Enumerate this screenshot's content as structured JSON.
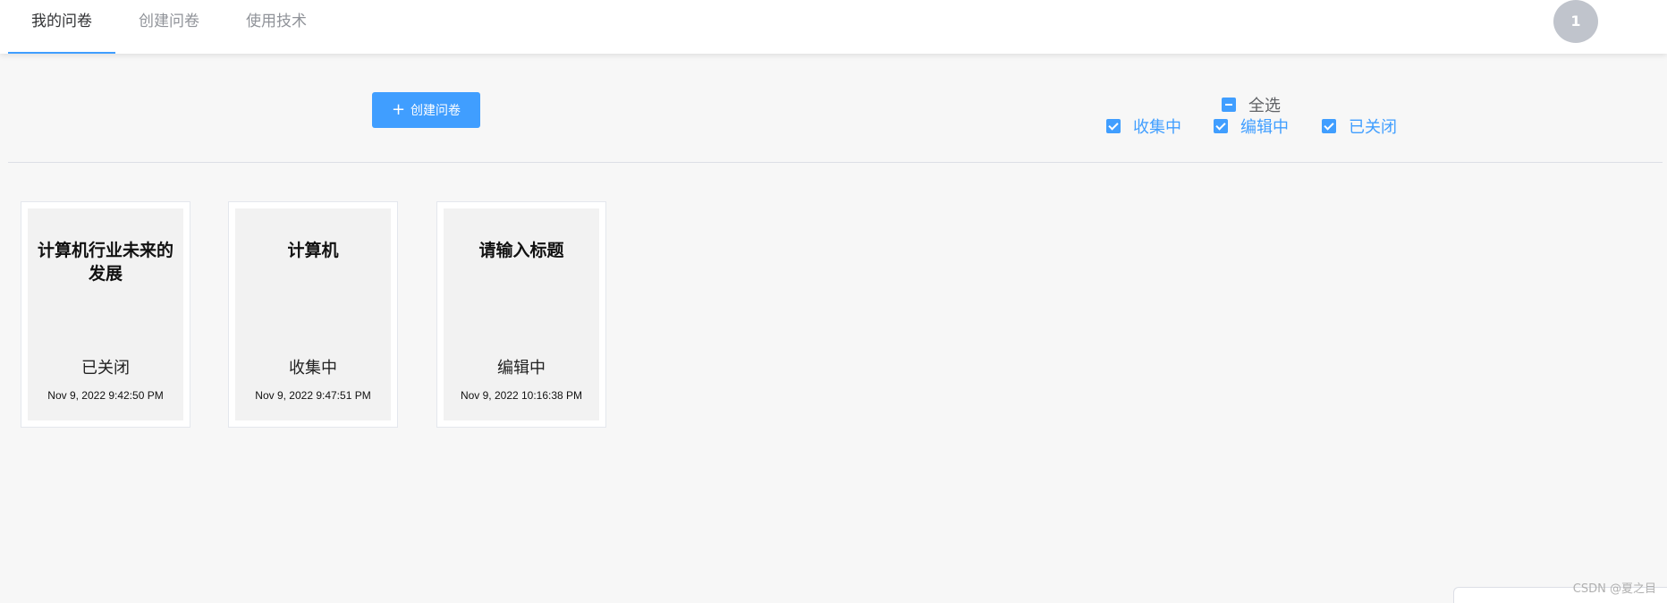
{
  "nav": {
    "tabs": [
      {
        "label": "我的问卷",
        "active": true
      },
      {
        "label": "创建问卷",
        "active": false
      },
      {
        "label": "使用技术",
        "active": false
      }
    ],
    "avatar_text": "1"
  },
  "toolbar": {
    "create_icon": "plus-icon",
    "create_label": "创建问卷",
    "select_all_label": "全选",
    "select_all_state": "indeterminate",
    "filters": [
      {
        "label": "收集中",
        "checked": true
      },
      {
        "label": "编辑中",
        "checked": true
      },
      {
        "label": "已关闭",
        "checked": true
      }
    ]
  },
  "cards": [
    {
      "title": "计算机行业未来的发展",
      "status": "已关闭",
      "time": "Nov 9, 2022 9:42:50 PM"
    },
    {
      "title": "计算机",
      "status": "收集中",
      "time": "Nov 9, 2022 9:47:51 PM"
    },
    {
      "title": "请输入标题",
      "status": "编辑中",
      "time": "Nov 9, 2022 10:16:38 PM"
    }
  ],
  "watermark": "CSDN @夏之目",
  "colors": {
    "primary": "#409eff",
    "background": "#f7f7f7",
    "card_inner": "#f2f2f2",
    "avatar": "#c0c4cc"
  }
}
